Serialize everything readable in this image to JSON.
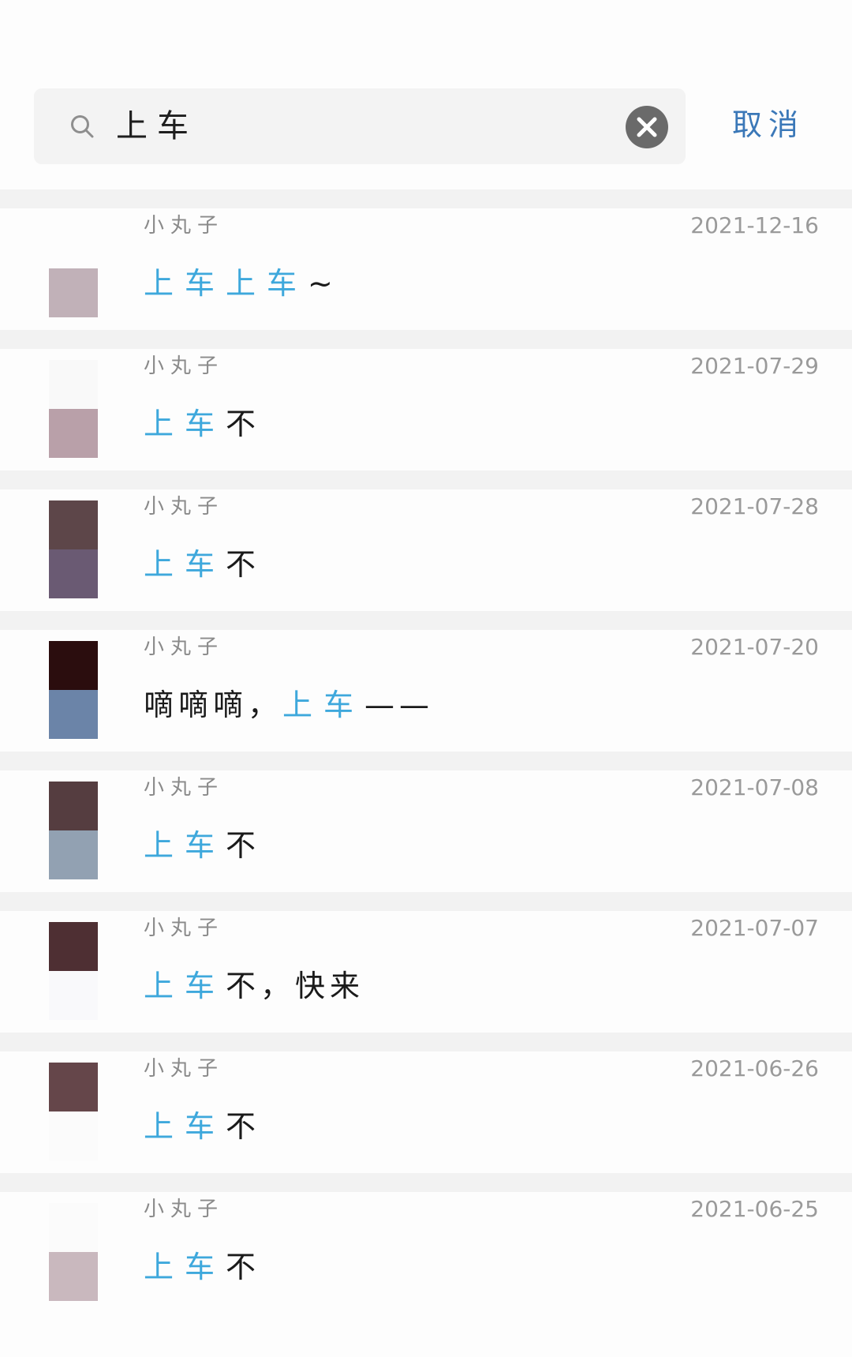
{
  "search": {
    "query": "上车",
    "cancel_label": "取消"
  },
  "colors": {
    "highlight": "#3ea8dc",
    "cancel": "#3b78b8",
    "clear_button": "#6a6a6a"
  },
  "results": [
    {
      "sender": "小丸子",
      "date": "2021-12-16",
      "avatar_colors": [
        "#fdfdfd",
        "#c1b1b8"
      ],
      "parts": [
        {
          "text": "上车上车",
          "hl": true
        },
        {
          "text": "~",
          "hl": false
        }
      ]
    },
    {
      "sender": "小丸子",
      "date": "2021-07-29",
      "avatar_colors": [
        "#f9f9f9",
        "#b9a0a9"
      ],
      "parts": [
        {
          "text": "上车",
          "hl": true
        },
        {
          "text": "不",
          "hl": false
        }
      ]
    },
    {
      "sender": "小丸子",
      "date": "2021-07-28",
      "avatar_colors": [
        "#5d4649",
        "#6a5a73"
      ],
      "parts": [
        {
          "text": "上车",
          "hl": true
        },
        {
          "text": "不",
          "hl": false
        }
      ]
    },
    {
      "sender": "小丸子",
      "date": "2021-07-20",
      "avatar_colors": [
        "#2b0d0e",
        "#6b84a8"
      ],
      "parts": [
        {
          "text": "嘀嘀嘀，",
          "hl": false
        },
        {
          "text": "上车",
          "hl": true
        },
        {
          "text": "——",
          "hl": false
        }
      ]
    },
    {
      "sender": "小丸子",
      "date": "2021-07-08",
      "avatar_colors": [
        "#553d40",
        "#92a1b2"
      ],
      "parts": [
        {
          "text": "上车",
          "hl": true
        },
        {
          "text": "不",
          "hl": false
        }
      ]
    },
    {
      "sender": "小丸子",
      "date": "2021-07-07",
      "avatar_colors": [
        "#4e2f33",
        "#f9f9fb"
      ],
      "parts": [
        {
          "text": "上车",
          "hl": true
        },
        {
          "text": "不，快来",
          "hl": false
        }
      ]
    },
    {
      "sender": "小丸子",
      "date": "2021-06-26",
      "avatar_colors": [
        "#65464a",
        "#fbfbfb"
      ],
      "parts": [
        {
          "text": "上车",
          "hl": true
        },
        {
          "text": "不",
          "hl": false
        }
      ]
    },
    {
      "sender": "小丸子",
      "date": "2021-06-25",
      "avatar_colors": [
        "#fbfbfb",
        "#c9b8be"
      ],
      "parts": [
        {
          "text": "上车",
          "hl": true
        },
        {
          "text": "不",
          "hl": false
        }
      ]
    }
  ]
}
